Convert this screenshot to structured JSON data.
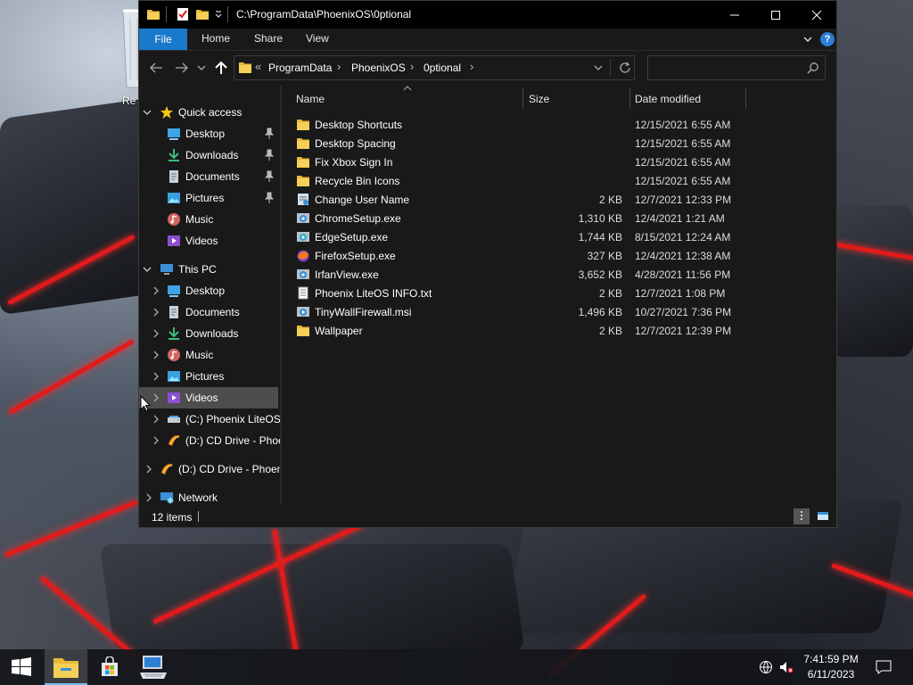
{
  "desktop": {
    "icons": [
      {
        "label": "Re",
        "icon": "recycle-bin-icon"
      }
    ]
  },
  "window": {
    "title": "C:\\ProgramData\\PhoenixOS\\0ptional",
    "quick_access_toolbar": [
      "folder-icon",
      "properties-icon",
      "new-folder-icon",
      "dropdown-icon"
    ],
    "controls": [
      "minimize-icon",
      "maximize-icon",
      "close-icon"
    ]
  },
  "ribbon": {
    "tabs": [
      "File",
      "Home",
      "Share",
      "View"
    ],
    "help_label": "?"
  },
  "address": {
    "overflow": "«",
    "crumbs": [
      "ProgramData",
      "PhoenixOS",
      "0ptional"
    ],
    "separator": "›",
    "search_placeholder": ""
  },
  "nav_pane": {
    "items": [
      {
        "label": "Quick access",
        "icon": "star-icon",
        "level": 0,
        "expanded": true
      },
      {
        "label": "Desktop",
        "icon": "desktop-folder-icon",
        "level": 1,
        "pinned": true
      },
      {
        "label": "Downloads",
        "icon": "downloads-icon",
        "level": 1,
        "pinned": true
      },
      {
        "label": "Documents",
        "icon": "documents-icon",
        "level": 1,
        "pinned": true
      },
      {
        "label": "Pictures",
        "icon": "pictures-icon",
        "level": 1,
        "pinned": true
      },
      {
        "label": "Music",
        "icon": "music-icon",
        "level": 1
      },
      {
        "label": "Videos",
        "icon": "videos-icon",
        "level": 1
      },
      {
        "label": "This PC",
        "icon": "this-pc-icon",
        "level": 0,
        "expanded": true
      },
      {
        "label": "Desktop",
        "icon": "desktop-folder-icon",
        "level": 1
      },
      {
        "label": "Documents",
        "icon": "documents-icon",
        "level": 1
      },
      {
        "label": "Downloads",
        "icon": "downloads-icon",
        "level": 1
      },
      {
        "label": "Music",
        "icon": "music-icon",
        "level": 1
      },
      {
        "label": "Pictures",
        "icon": "pictures-icon",
        "level": 1
      },
      {
        "label": "Videos",
        "icon": "videos-icon",
        "level": 1,
        "selected": true
      },
      {
        "label": "(C:) Phoenix LiteOS",
        "icon": "drive-icon",
        "level": 1
      },
      {
        "label": "(D:) CD Drive - Phoe",
        "icon": "cd-drive-icon",
        "level": 1
      },
      {
        "label": "(D:) CD Drive - Phoen",
        "icon": "cd-drive-icon",
        "level": 0
      },
      {
        "label": "Network",
        "icon": "network-icon",
        "level": 0
      }
    ]
  },
  "file_list": {
    "columns": {
      "name": "Name",
      "size": "Size",
      "date": "Date modified"
    },
    "rows": [
      {
        "name": "Desktop Shortcuts",
        "size": "",
        "date": "12/15/2021 6:55 AM",
        "icon": "folder-icon"
      },
      {
        "name": "Desktop Spacing",
        "size": "",
        "date": "12/15/2021 6:55 AM",
        "icon": "folder-icon"
      },
      {
        "name": "Fix Xbox Sign In",
        "size": "",
        "date": "12/15/2021 6:55 AM",
        "icon": "folder-icon"
      },
      {
        "name": "Recycle Bin Icons",
        "size": "",
        "date": "12/15/2021 6:55 AM",
        "icon": "folder-icon"
      },
      {
        "name": "Change User Name",
        "size": "2 KB",
        "date": "12/7/2021 12:33 PM",
        "icon": "script-icon"
      },
      {
        "name": "ChromeSetup.exe",
        "size": "1,310 KB",
        "date": "12/4/2021 1:21 AM",
        "icon": "installer-icon"
      },
      {
        "name": "EdgeSetup.exe",
        "size": "1,744 KB",
        "date": "8/15/2021 12:24 AM",
        "icon": "installer-icon"
      },
      {
        "name": "FirefoxSetup.exe",
        "size": "327 KB",
        "date": "12/4/2021 12:38 AM",
        "icon": "firefox-icon"
      },
      {
        "name": "IrfanView.exe",
        "size": "3,652 KB",
        "date": "4/28/2021 11:56 PM",
        "icon": "installer-icon"
      },
      {
        "name": "Phoenix LiteOS INFO.txt",
        "size": "2 KB",
        "date": "12/7/2021 1:08 PM",
        "icon": "text-file-icon"
      },
      {
        "name": "TinyWallFirewall.msi",
        "size": "1,496 KB",
        "date": "10/27/2021 7:36 PM",
        "icon": "installer-icon"
      },
      {
        "name": "Wallpaper",
        "size": "2 KB",
        "date": "12/7/2021 12:39 PM",
        "icon": "folder-icon"
      }
    ]
  },
  "status": {
    "items": "12 items"
  },
  "taskbar": {
    "apps": [
      "start-icon",
      "file-explorer-icon",
      "store-icon",
      "computer-icon"
    ],
    "tray": [
      "network-globe-icon",
      "volume-muted-icon"
    ],
    "time": "7:41:59 PM",
    "date": "6/11/2023"
  },
  "colors": {
    "accent": "#1979ca",
    "window_bg": "#191919",
    "title_bg": "#000000",
    "selected": "#4d4d4d"
  }
}
